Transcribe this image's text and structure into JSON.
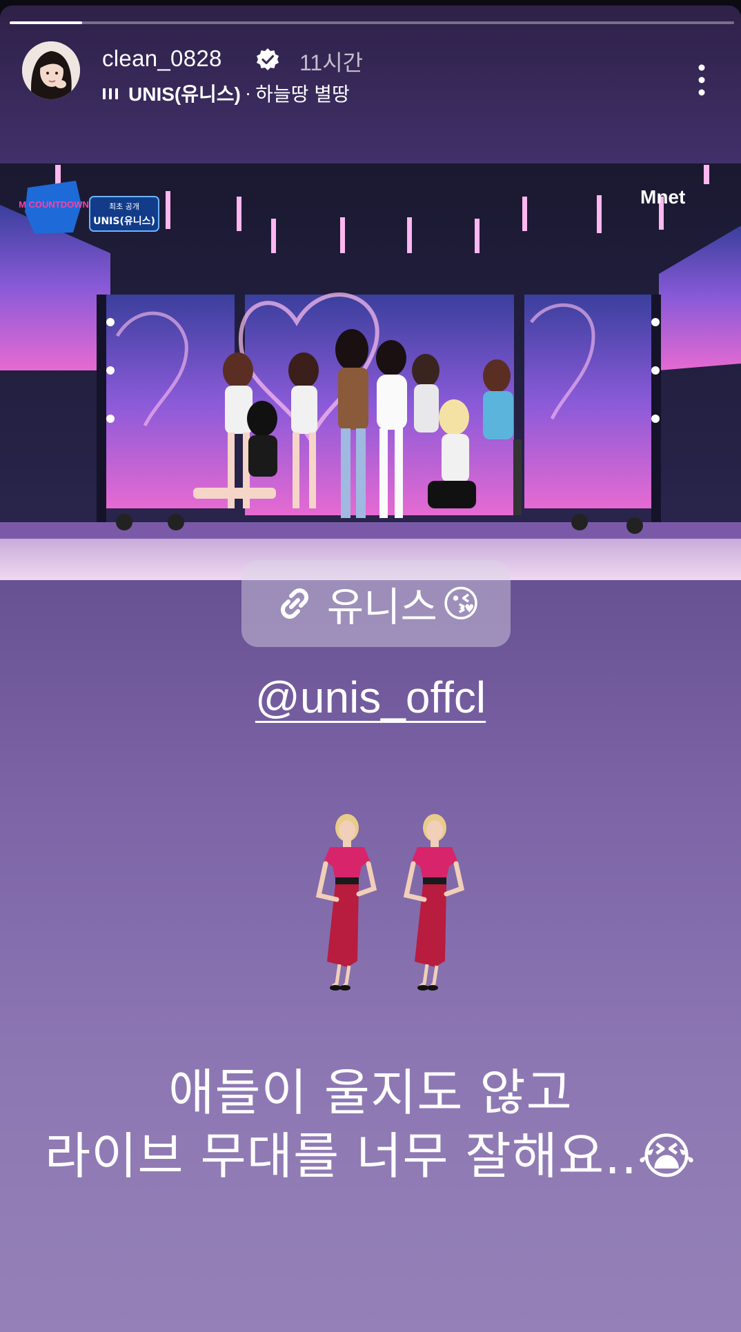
{
  "story": {
    "progress_fraction": 0.1,
    "username": "clean_0828",
    "time_ago": "11시간",
    "music": {
      "artist": "UNIS(유니스)",
      "separator": "·",
      "song": "하늘땅 별땅"
    },
    "icons": {
      "verified": "verified-badge-icon",
      "music": "music-bars-icon",
      "more": "more-vertical-icon",
      "link": "link-icon"
    }
  },
  "video": {
    "show_logo": "M COUNTDOWN",
    "badge_top": "최초 공개",
    "badge_bottom": "UNIS(유니스)",
    "channel_logo": "Mnet"
  },
  "link_sticker": {
    "label": "유니스",
    "emoji": "😘"
  },
  "mention": "@unis_offcl",
  "caption": {
    "line1": "애들이 울지도 않고",
    "line2": "라이브 무대를 너무 잘해요..",
    "emoji": "😭"
  },
  "colors": {
    "bg_top": "#2e2148",
    "bg_bottom": "#9581b7",
    "accent_pink": "#ff5fd2"
  }
}
